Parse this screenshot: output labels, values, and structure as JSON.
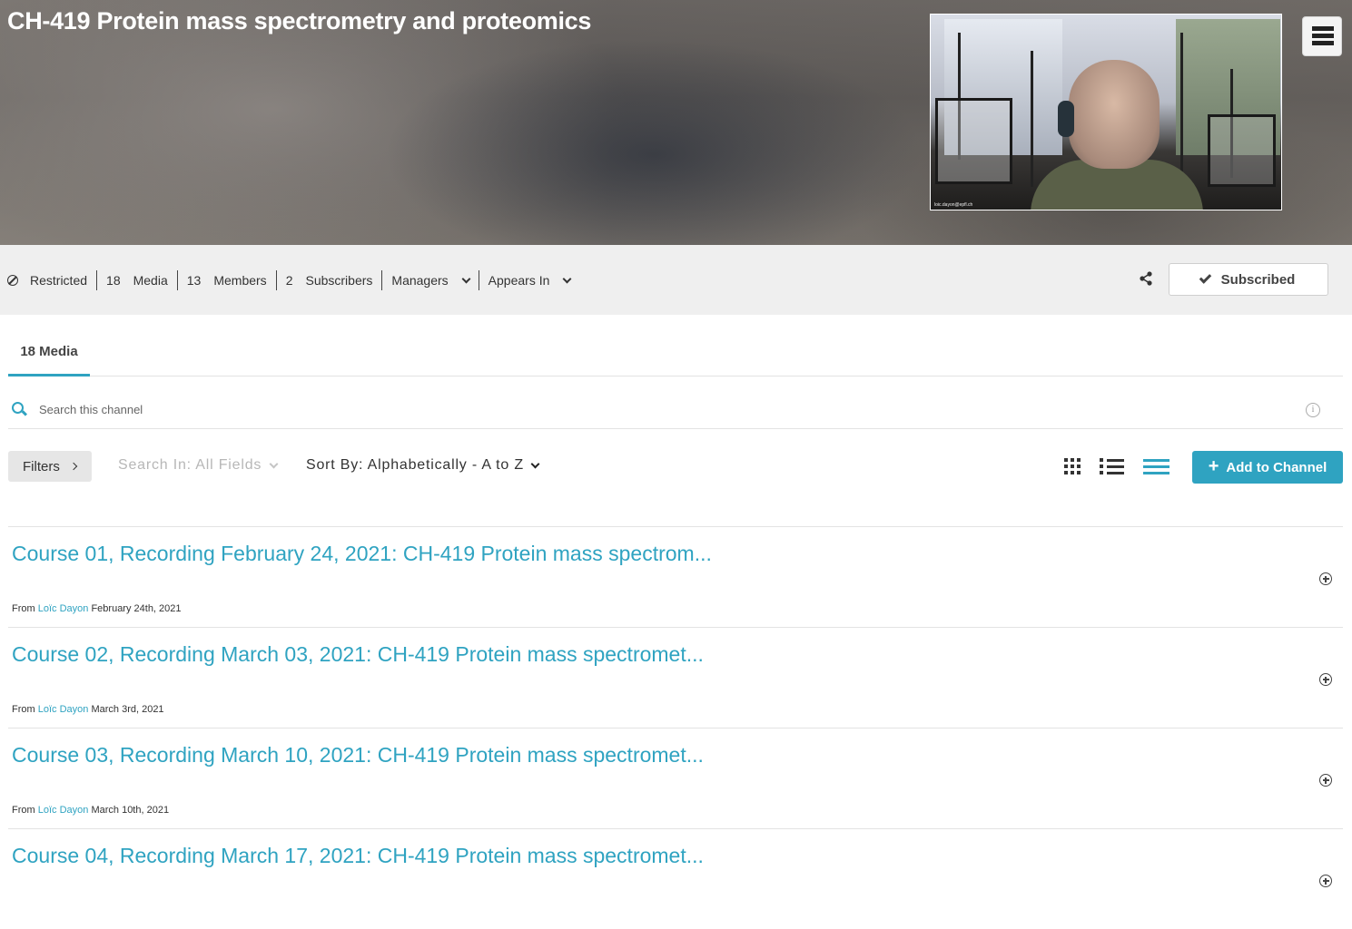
{
  "channel": {
    "title": "CH-419 Protein mass spectrometry and proteomics",
    "thumbnail_caption": "loic.dayon@epfl.ch"
  },
  "info_bar": {
    "restricted": "Restricted",
    "media_count": "18",
    "media_label": "Media",
    "members_count": "13",
    "members_label": "Members",
    "subscribers_count": "2",
    "subscribers_label": "Subscribers",
    "managers_label": "Managers",
    "appears_in_label": "Appears In",
    "subscribed_label": "Subscribed"
  },
  "tabs": [
    {
      "label": "18 Media",
      "active": true
    }
  ],
  "search": {
    "placeholder": "Search this channel",
    "value": ""
  },
  "controls": {
    "filters_label": "Filters",
    "search_in_label": "Search In: All Fields",
    "sort_by_label": "Sort By: Alphabetically - A to Z",
    "add_to_channel_label": "Add to Channel",
    "active_view": "compact-list"
  },
  "media": [
    {
      "title": "Course 01, Recording February 24, 2021: CH-419 Protein mass spectrom...",
      "from": "From",
      "author": "Loïc Dayon",
      "date": "February 24th, 2021"
    },
    {
      "title": "Course 02, Recording March 03, 2021: CH-419 Protein mass spectromet...",
      "from": "From",
      "author": "Loïc Dayon",
      "date": "March 3rd, 2021"
    },
    {
      "title": "Course 03, Recording March 10, 2021: CH-419 Protein mass spectromet...",
      "from": "From",
      "author": "Loïc Dayon",
      "date": "March 10th, 2021"
    },
    {
      "title": "Course 04, Recording March 17, 2021: CH-419 Protein mass spectromet...",
      "from": "",
      "author": "",
      "date": ""
    }
  ],
  "colors": {
    "accent": "#2fa3c1",
    "info_bar_bg": "#efefef",
    "filters_bg": "#e6e6e6"
  }
}
